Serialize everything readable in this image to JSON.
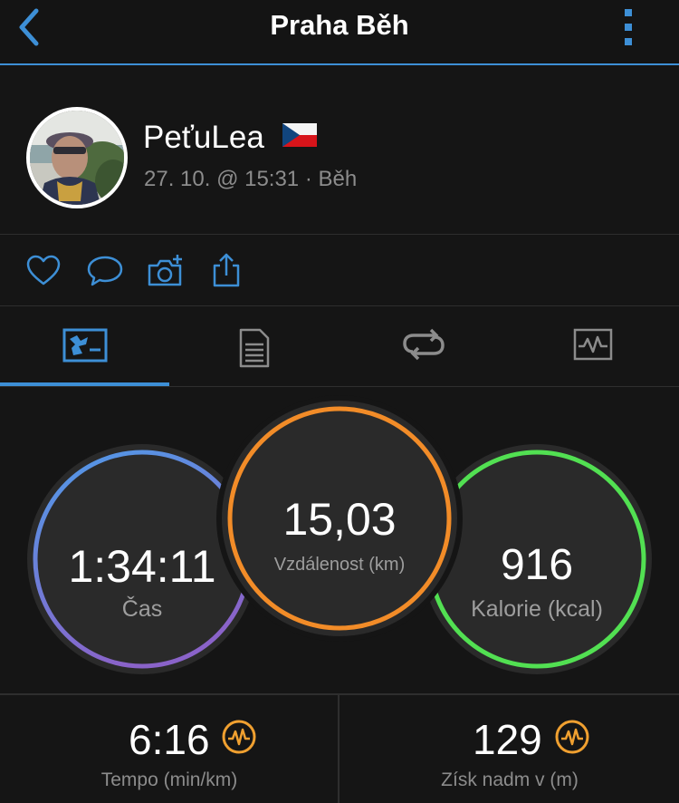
{
  "header": {
    "title": "Praha Běh"
  },
  "profile": {
    "username": "PeťuLea",
    "subtitle": "27. 10. @ 15:31 · Běh"
  },
  "actions": [
    "heart-icon",
    "comment-icon",
    "camera-add-icon",
    "share-icon"
  ],
  "tabs": [
    {
      "icon": "stats-summary-icon",
      "active": true
    },
    {
      "icon": "document-list-icon",
      "active": false
    },
    {
      "icon": "laps-loop-icon",
      "active": false
    },
    {
      "icon": "chart-icon",
      "active": false
    }
  ],
  "metrics": {
    "time": {
      "value": "1:34:11",
      "label": "Čas"
    },
    "distance": {
      "value": "15,03",
      "label": "Vzdálenost (km)"
    },
    "calories": {
      "value": "916",
      "label": "Kalorie (kcal)"
    }
  },
  "stats": {
    "pace": {
      "value": "6:16",
      "label": "Tempo (min/km)"
    },
    "elevation": {
      "value": "129",
      "label": "Získ nadm v (m)"
    }
  },
  "colors": {
    "accent": "#3d8fd6",
    "time_ring_start": "#4f9be8",
    "time_ring_end": "#8a63c9",
    "distance_ring": "#f28c28",
    "calories_ring": "#52e052",
    "badge": "#f0a030"
  }
}
